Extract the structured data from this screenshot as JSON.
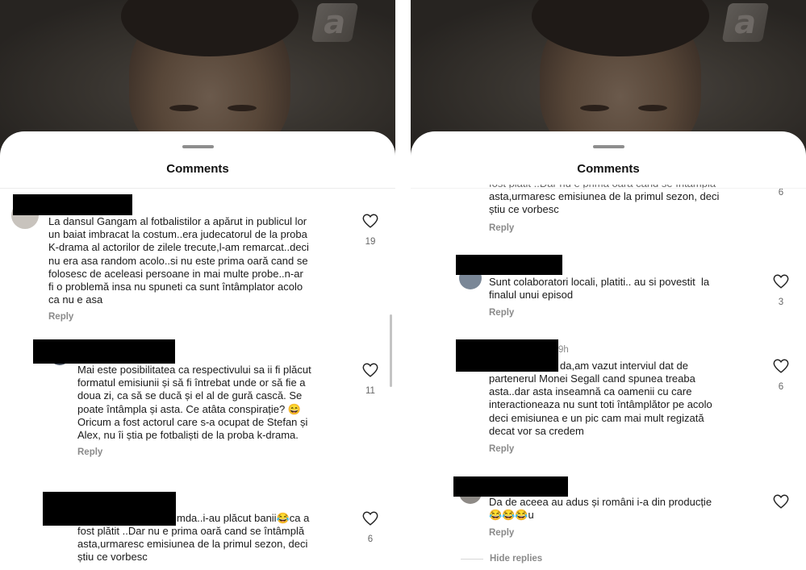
{
  "sheet": {
    "title": "Comments"
  },
  "colors": {
    "redaction": "#000000",
    "secondary_text": "#8a8a8a",
    "video_bg": "#2e2a26"
  },
  "left": {
    "comments": [
      {
        "text": "La dansul Gangam al fotbalistilor a apărut in publicul lor\nun baiat imbracat la costum..era judecatorul de la proba\nK-drama al actorilor de zilele trecute,l-am remarcat..deci\nnu era asa random acolo..si nu este prima oară cand se\nfolosesc de aceleasi persoane in mai multe probe..n-ar\nfi o problemă insa nu spuneti ca sunt întâmplator acolo\nca nu e asa",
        "reply": "Reply",
        "likes": "19",
        "icon": "heart-outline-icon"
      },
      {
        "text": "Mai este posibilitatea ca respectivului sa ii fi plăcut\nformatul emisiunii și să fi întrebat unde or să fie a\ndoua zi, ca să se ducă și el al de gură cască. Se\npoate întâmpla și asta. Ce atâta conspirație? 😄\nOricum a fost actorul care s-a ocupat de Stefan și\nAlex, nu îi știa pe fotbaliști de la proba k-drama.",
        "reply": "Reply",
        "likes": "11",
        "icon": "heart-outline-icon"
      },
      {
        "text_first": "mda..i-au plăcut banii😂ca a",
        "text": "fost plătit ..Dar nu e prima oară cand se întâmplă\nasta,urmaresc emisiunea de la primul sezon, deci\nștiu ce vorbesc",
        "likes": "6",
        "icon": "heart-outline-icon"
      }
    ]
  },
  "right": {
    "comments": [
      {
        "text_partial": "fost plătit ..Dar nu e prima oară cand se întâmplă",
        "text": "asta,urmaresc emisiunea de la primul sezon, deci\nștiu ce vorbesc",
        "reply": "Reply",
        "likes": "6"
      },
      {
        "text": "Sunt colaboratori locali, platiti.. au si povestit  la\nfinalul unui episod",
        "reply": "Reply",
        "likes": "3",
        "icon": "heart-outline-icon"
      },
      {
        "time": "9h",
        "text_first": "da,am vazut interviul dat de",
        "text": "partenerul Monei Segall cand spunea treaba\nasta..dar asta inseamnă ca oamenii cu care\ninteractioneaza nu sunt toti întâmplător pe acolo\ndeci emisiunea e un pic cam mai mult regizată\ndecat vor sa credem",
        "reply": "Reply",
        "likes": "6",
        "icon": "heart-outline-icon"
      },
      {
        "text": "Da de aceea au adus și români i-a din producție\n😂😂😂u",
        "reply": "Reply",
        "icon": "heart-outline-icon"
      }
    ],
    "hide_replies": "Hide replies"
  }
}
